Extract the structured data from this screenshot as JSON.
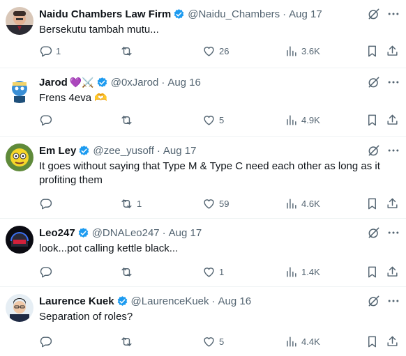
{
  "posts": [
    {
      "name": "Naidu Chambers Law Firm",
      "emoji": "",
      "handle": "@Naidu_Chambers",
      "date": "Aug 17",
      "text": "Bersekutu tambah mutu...",
      "replies": "1",
      "reposts": "",
      "likes": "26",
      "views": "3.6K"
    },
    {
      "name": "Jarod",
      "emoji": "💜⚔️",
      "handle": "@0xJarod",
      "date": "Aug 16",
      "text": "Frens 4eva 🫶",
      "replies": "",
      "reposts": "",
      "likes": "5",
      "views": "4.9K"
    },
    {
      "name": "Em Ley",
      "emoji": "",
      "handle": "@zee_yusoff",
      "date": "Aug 17",
      "text": "It goes without saying that Type M & Type C need each other as long as it profiting them",
      "replies": "",
      "reposts": "1",
      "likes": "59",
      "views": "4.6K"
    },
    {
      "name": "Leo247",
      "emoji": "",
      "handle": "@DNALeo247",
      "date": "Aug 17",
      "text": "look...pot calling kettle black...",
      "replies": "",
      "reposts": "",
      "likes": "1",
      "views": "1.4K"
    },
    {
      "name": "Laurence Kuek",
      "emoji": "",
      "handle": "@LaurenceKuek",
      "date": "Aug 16",
      "text": "Separation of roles?",
      "replies": "",
      "reposts": "",
      "likes": "5",
      "views": "4.4K"
    }
  ],
  "separator": "·",
  "colors": {
    "verified": "#1d9bf0",
    "text_primary": "#0f1419",
    "text_secondary": "#536471",
    "divider": "#eff3f4"
  },
  "icons": {
    "reply": "reply-icon",
    "repost": "repost-icon",
    "like": "like-icon",
    "views": "views-icon",
    "bookmark": "bookmark-icon",
    "share": "share-icon",
    "grok": "grok-icon",
    "more": "more-icon",
    "verified": "verified-badge-icon"
  }
}
